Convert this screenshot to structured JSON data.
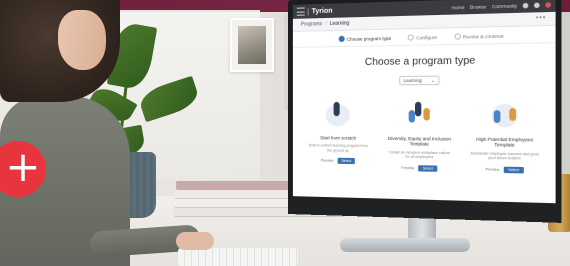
{
  "app": {
    "brand": "Tyrion",
    "top_links": [
      "Home",
      "Browse",
      "Community"
    ]
  },
  "breadcrumb": {
    "root": "Programs",
    "separator": "/",
    "current": "Learning",
    "more": "•••"
  },
  "steps": [
    {
      "label": "Choose program type",
      "active": true
    },
    {
      "label": "Configure",
      "active": false
    },
    {
      "label": "Review & continue",
      "active": false
    }
  ],
  "page": {
    "heading": "Choose a program type",
    "select_value": "Learning"
  },
  "cards": [
    {
      "title": "Start from scratch",
      "desc": "Build a custom learning program from the ground up",
      "link": "Preview",
      "button": "Select"
    },
    {
      "title": "Diversity, Equity and Inclusion Template",
      "desc": "Create an inclusive workplace culture for all employees",
      "link": "Preview",
      "button": "Select"
    },
    {
      "title": "High Potential Employees Template",
      "desc": "Accelerate employee success and grow your future leaders",
      "link": "Preview",
      "button": "Select"
    }
  ],
  "badge": {
    "symbol": "+",
    "color": "#e8343c"
  },
  "colors": {
    "accent": "#3a6fb0",
    "topbar": "#3a3c41",
    "brand_band": "#6a1f3a"
  }
}
